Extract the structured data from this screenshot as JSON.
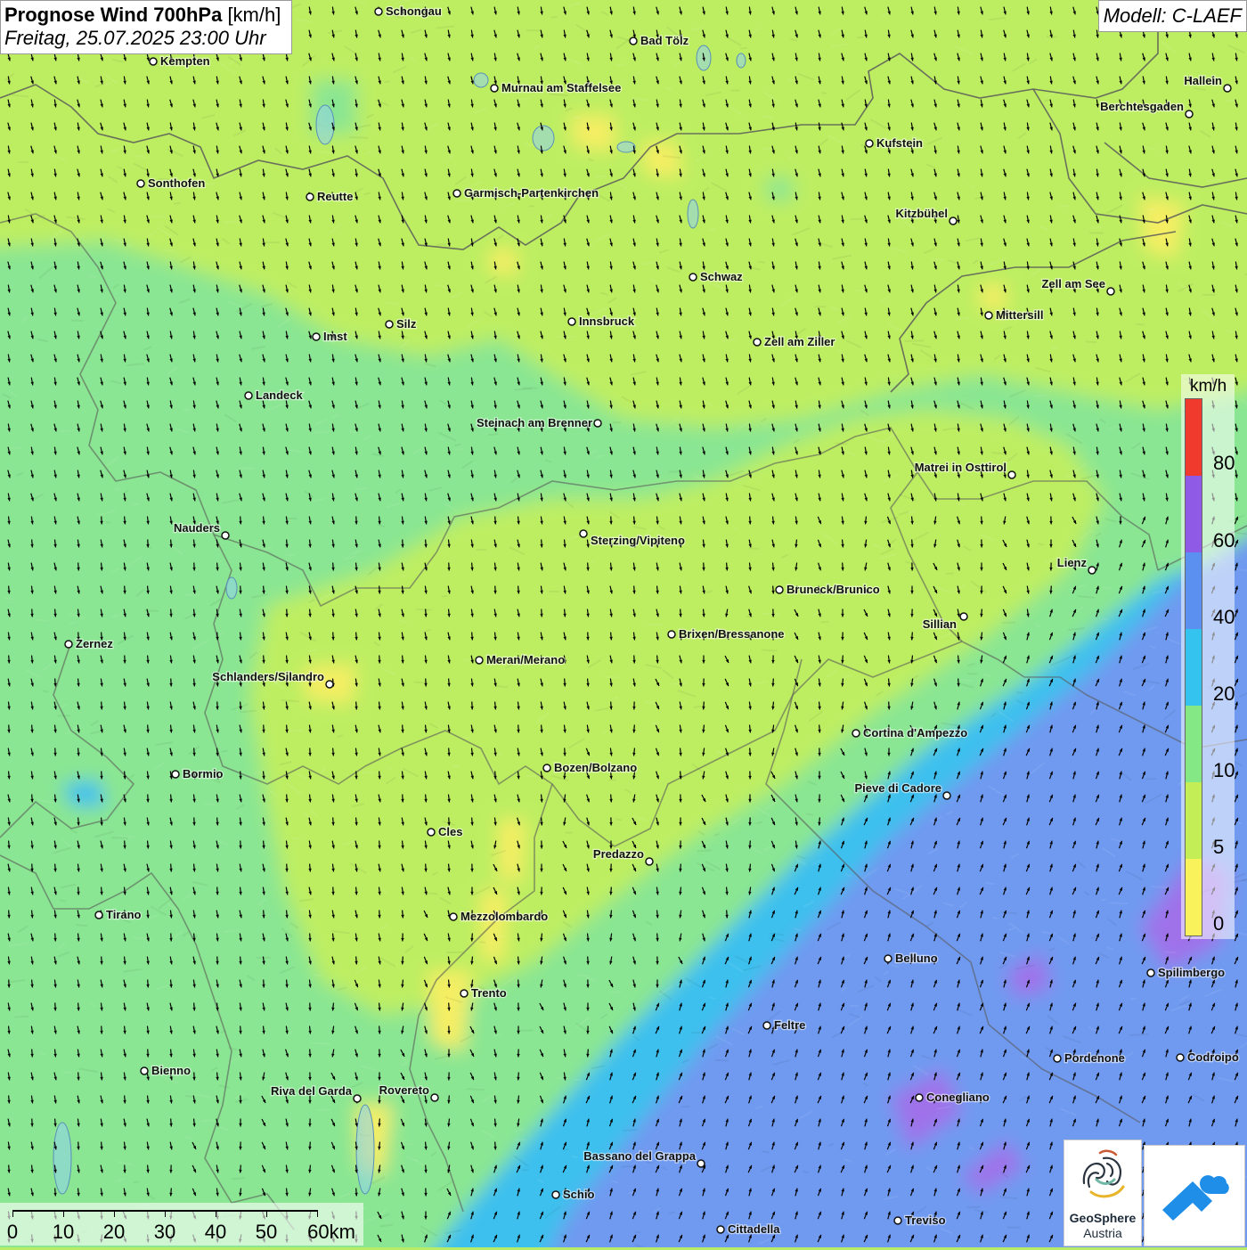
{
  "header": {
    "title_main": "Prognose Wind 700hPa",
    "title_unit": "[km/h]",
    "datetime": "Freitag, 25.07.2025 23:00 Uhr",
    "model": "Modell: C-LAEF"
  },
  "legend": {
    "unit": "km/h",
    "ticks": [
      "80",
      "60",
      "40",
      "20",
      "10",
      "5",
      "0"
    ],
    "colors_top_to_bottom": [
      "#f03a2e",
      "#8f5ae6",
      "#5b8ff0",
      "#34c2ef",
      "#84e884",
      "#c4ee55",
      "#faf25a"
    ]
  },
  "map": {
    "zone_colors": {
      "yellow": "#f6ee63",
      "yellow_green": "#bdee62",
      "green": "#8ae692",
      "cyan": "#3ec0ee",
      "blue": "#6f9af0",
      "violet": "#9f72ea"
    },
    "arrow_color": "#000000",
    "border_color": "#5a5a5a",
    "arrow_direction": "predominantly from north-west; south-west winds in the south-east",
    "cities": [
      {
        "name": "Schongau"
      },
      {
        "name": "Bad Tölz"
      },
      {
        "name": "Kempten"
      },
      {
        "name": "Murnau am Staffelsee"
      },
      {
        "name": "Hallein"
      },
      {
        "name": "Berchtesgaden"
      },
      {
        "name": "Kufstein"
      },
      {
        "name": "Sonthofen"
      },
      {
        "name": "Reutte"
      },
      {
        "name": "Garmisch-Partenkirchen"
      },
      {
        "name": "Kitzbühel"
      },
      {
        "name": "Schwaz"
      },
      {
        "name": "Zell am See"
      },
      {
        "name": "Mittersill"
      },
      {
        "name": "Imst"
      },
      {
        "name": "Silz"
      },
      {
        "name": "Innsbruck"
      },
      {
        "name": "Zell am Ziller"
      },
      {
        "name": "Landeck"
      },
      {
        "name": "Steinach am Brenner"
      },
      {
        "name": "Matrei in Osttirol"
      },
      {
        "name": "Nauders"
      },
      {
        "name": "Sterzing/Vipiteno"
      },
      {
        "name": "Lienz"
      },
      {
        "name": "Bruneck/Brunico"
      },
      {
        "name": "Sillian"
      },
      {
        "name": "Zernez"
      },
      {
        "name": "Brixen/Bressanone"
      },
      {
        "name": "Meran/Merano"
      },
      {
        "name": "Schlanders/Silandro"
      },
      {
        "name": "Cortina d'Ampezzo"
      },
      {
        "name": "Bormio"
      },
      {
        "name": "Bozen/Bolzano"
      },
      {
        "name": "Pieve di Cadore"
      },
      {
        "name": "Cles"
      },
      {
        "name": "Predazzo"
      },
      {
        "name": "Tirano"
      },
      {
        "name": "Mezzolombardo"
      },
      {
        "name": "Belluno"
      },
      {
        "name": "Spilimbergo"
      },
      {
        "name": "Trento"
      },
      {
        "name": "Feltre"
      },
      {
        "name": "Bienno"
      },
      {
        "name": "Pordenone"
      },
      {
        "name": "Codroipo"
      },
      {
        "name": "Riva del Garda"
      },
      {
        "name": "Rovereto"
      },
      {
        "name": "Conegliano"
      },
      {
        "name": "Bassano del Grappa"
      },
      {
        "name": "Schio"
      },
      {
        "name": "Treviso"
      },
      {
        "name": "Cittadella"
      }
    ]
  },
  "scale": {
    "labels": [
      "0",
      "10",
      "20",
      "30",
      "40",
      "50",
      "60km"
    ]
  },
  "logos": {
    "geosphere_name": "GeoSphere",
    "geosphere_sub": "Austria"
  }
}
